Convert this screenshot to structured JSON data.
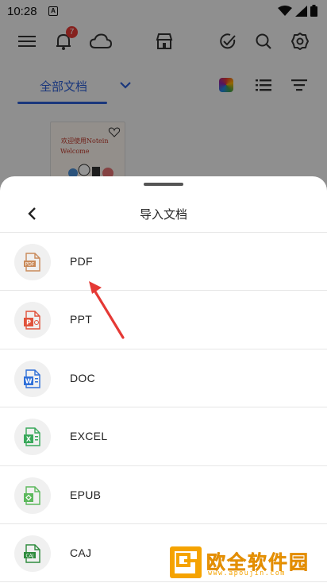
{
  "status_bar": {
    "time": "10:28",
    "notification_letter": "A"
  },
  "toolbar": {
    "notification_badge": "7"
  },
  "tabs": {
    "active_label": "全部文档"
  },
  "document": {
    "thumb_title_line1": "欢迎使用Notein",
    "thumb_title_line2": "Welcome"
  },
  "import_sheet": {
    "title": "导入文档",
    "items": [
      {
        "label": "PDF",
        "icon": "pdf-file-icon",
        "color": "#c98a5a"
      },
      {
        "label": "PPT",
        "icon": "ppt-file-icon",
        "color": "#e0533c"
      },
      {
        "label": "DOC",
        "icon": "doc-file-icon",
        "color": "#2f6fd8"
      },
      {
        "label": "EXCEL",
        "icon": "excel-file-icon",
        "color": "#39a85a"
      },
      {
        "label": "EPUB",
        "icon": "epub-file-icon",
        "color": "#5cb85c"
      },
      {
        "label": "CAJ",
        "icon": "caj-file-icon",
        "color": "#2e8b3d"
      }
    ]
  },
  "watermark": {
    "name": "欧全软件园",
    "url": "www.apoujin.com"
  },
  "colors": {
    "accent": "#2d5fd6",
    "annotation_arrow": "#e53935",
    "watermark": "#f5a300"
  }
}
